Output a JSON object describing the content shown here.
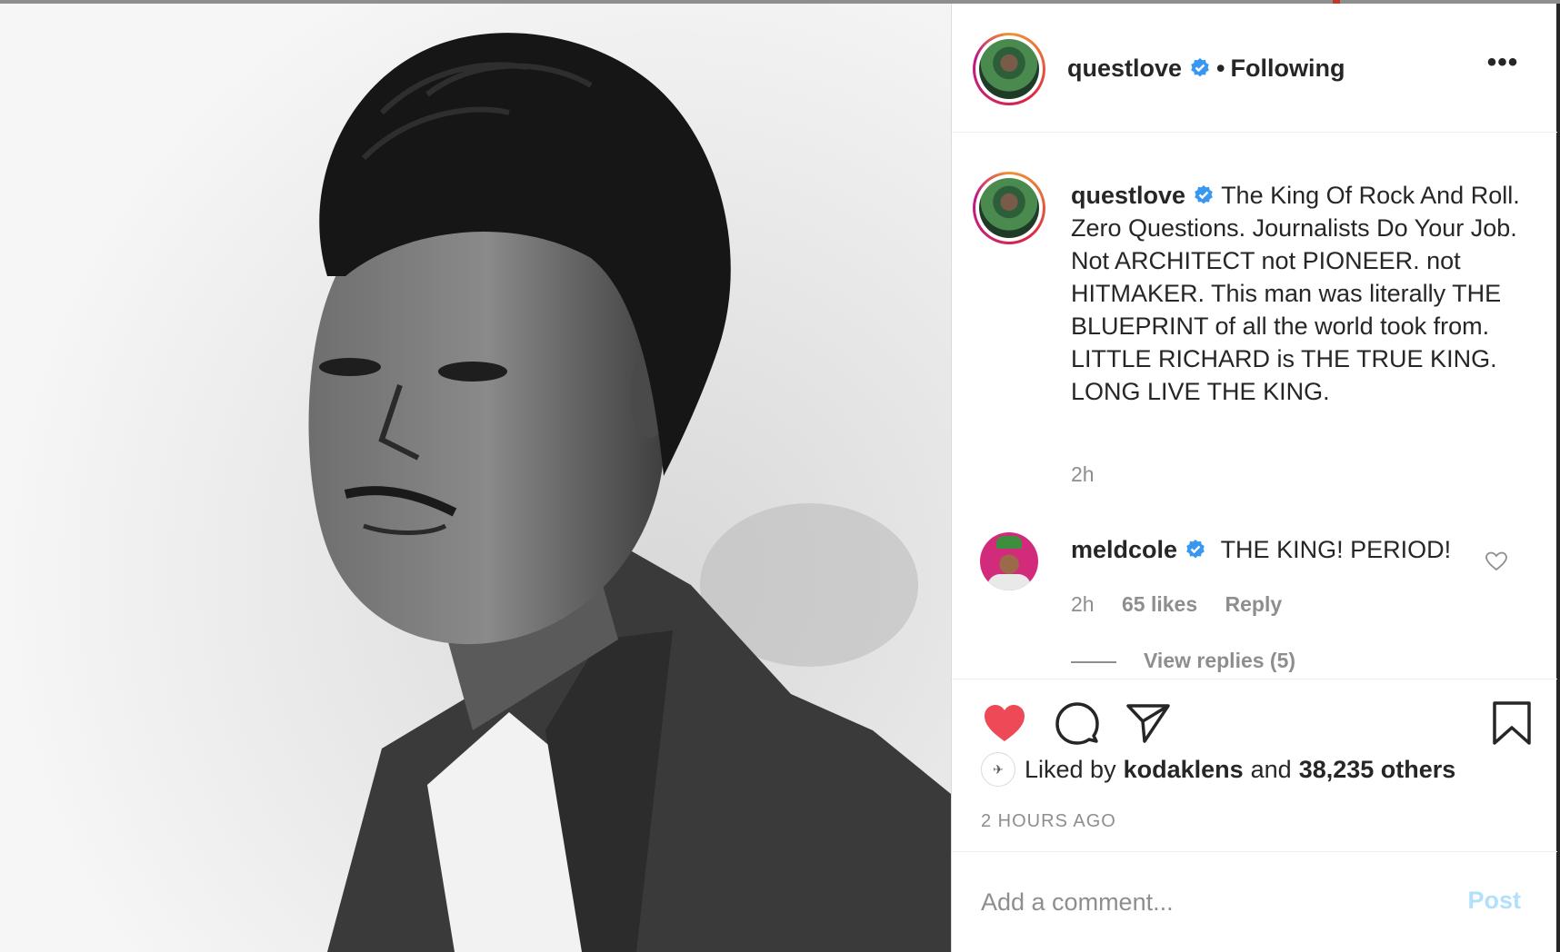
{
  "post": {
    "author": "questlove",
    "verified": true,
    "follow_status": "Following",
    "separator": "•",
    "more_label": "•••",
    "caption": "The King Of Rock And Roll. Zero Questions. Journalists Do Your Job. Not ARCHITECT not PIONEER. not HITMAKER. This man was literally THE BLUEPRINT of all the world took from. LITTLE RICHARD is THE TRUE KING. LONG LIVE THE KING.",
    "caption_time": "2h"
  },
  "comments": [
    {
      "username": "meldcole",
      "verified": true,
      "text": "THE KING! PERIOD!",
      "time": "2h",
      "likes": "65 likes",
      "reply_label": "Reply",
      "view_replies": "View replies (5)"
    }
  ],
  "actions": {
    "liked_prefix": "Liked by",
    "liked_user": "kodaklens",
    "liked_joiner": "and",
    "liked_others": "38,235 others",
    "time_ago": "2 HOURS AGO",
    "liked": true
  },
  "comment_box": {
    "placeholder": "Add a comment...",
    "post_label": "Post"
  },
  "icons": {
    "like": "heart-filled-icon",
    "comment": "comment-bubble-icon",
    "share": "paper-plane-icon",
    "save": "bookmark-icon",
    "verified": "verified-badge-icon",
    "more": "more-options-icon"
  },
  "colors": {
    "heart": "#ed4956",
    "verified": "#3897f0",
    "post_button_disabled": "#b2dffc",
    "muted_text": "#8e8e8e"
  }
}
